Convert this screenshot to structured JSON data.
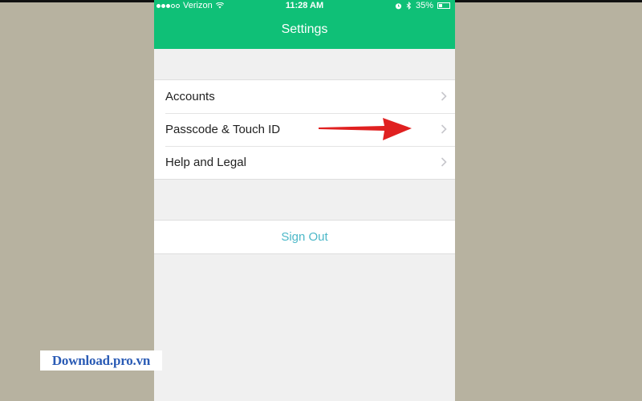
{
  "status_bar": {
    "carrier": "Verizon",
    "time": "11:28 AM",
    "battery": "35%",
    "battery_level": 0.35,
    "icons": [
      "signal-dots-icon",
      "wifi-icon",
      "alarm-icon",
      "bluetooth-icon",
      "battery-icon"
    ]
  },
  "nav": {
    "title": "Settings"
  },
  "menu": {
    "items": [
      {
        "label": "Accounts",
        "icon": "chevron-right-icon"
      },
      {
        "label": "Passcode & Touch ID",
        "icon": "chevron-right-icon"
      },
      {
        "label": "Help and Legal",
        "icon": "chevron-right-icon"
      }
    ]
  },
  "signout": {
    "label": "Sign Out"
  },
  "annotation": {
    "icon": "red-arrow-icon",
    "color": "#e02020"
  },
  "watermark": {
    "text": "Download.pro.vn"
  },
  "colors": {
    "accent": "#0fc077",
    "link": "#4cb8c8"
  }
}
